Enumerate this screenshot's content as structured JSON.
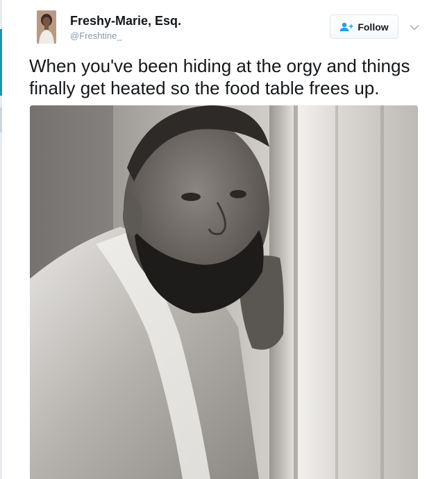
{
  "tweet": {
    "author": {
      "name": "Freshy-Marie, Esq.",
      "handle": "@Freshtine_",
      "avatar_icon": "profile-avatar"
    },
    "follow_button": {
      "label": "Follow",
      "icon": "follow-person-plus-icon",
      "color": "#1da1f2"
    },
    "menu_icon": "chevron-down-icon",
    "text": "When you've been hiding at the orgy and things finally get heated so the food table frees up.",
    "media": {
      "type": "photo",
      "description": "Black-and-white photo of a bearded man in a white robe peeking from behind a door frame"
    }
  }
}
